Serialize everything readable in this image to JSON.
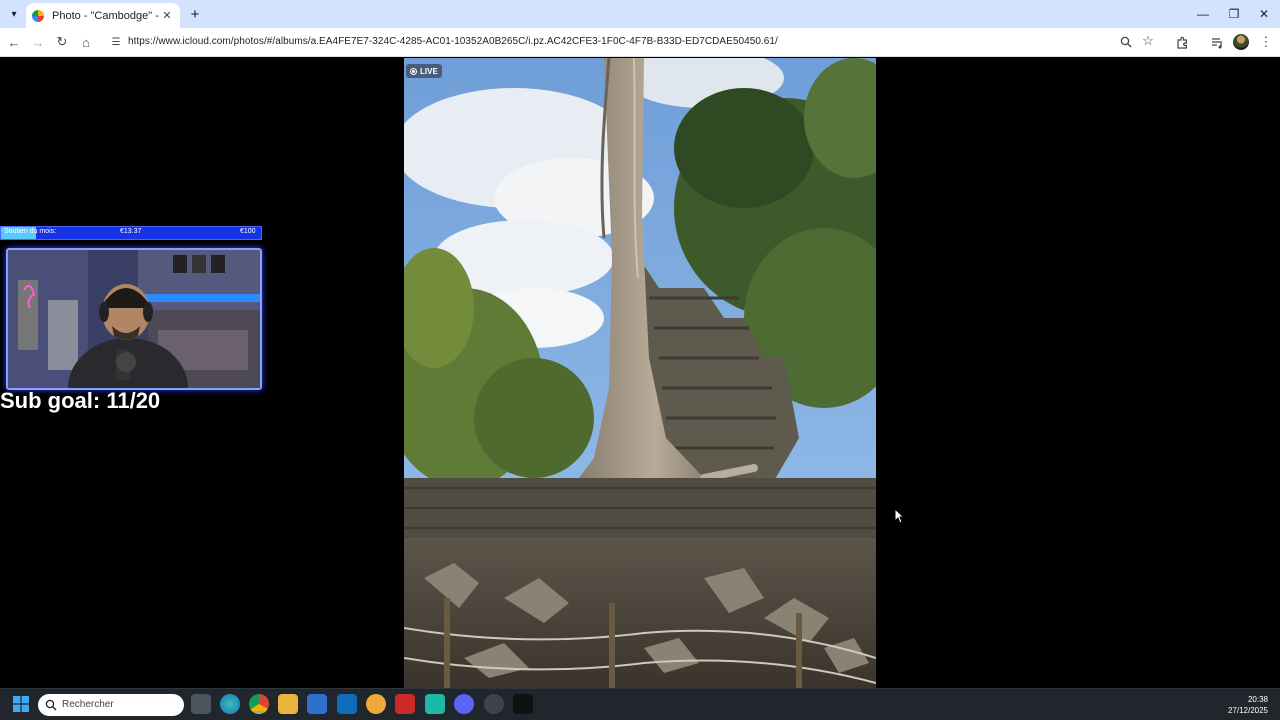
{
  "browser": {
    "tab_title": "Photo - \"Cambodge\" - iCloud P",
    "url": "https://www.icloud.com/photos/#/albums/a.EA4FE7E7-324C-4285-AC01-10352A0B265C/i.pz.AC42CFE3-1F0C-4F7B-B33D-ED7CDAE50450.61/"
  },
  "photo": {
    "live_label": "LIVE"
  },
  "stream_overlay": {
    "goal_label": "Soutien du mois:",
    "goal_current": "€13.37",
    "goal_target": "€100",
    "goal_progress": 0.1337,
    "sub_goal": "Sub goal: 11/20"
  },
  "taskbar": {
    "search_placeholder": "Rechercher",
    "time": "20:38",
    "date": "27/12/2025"
  }
}
